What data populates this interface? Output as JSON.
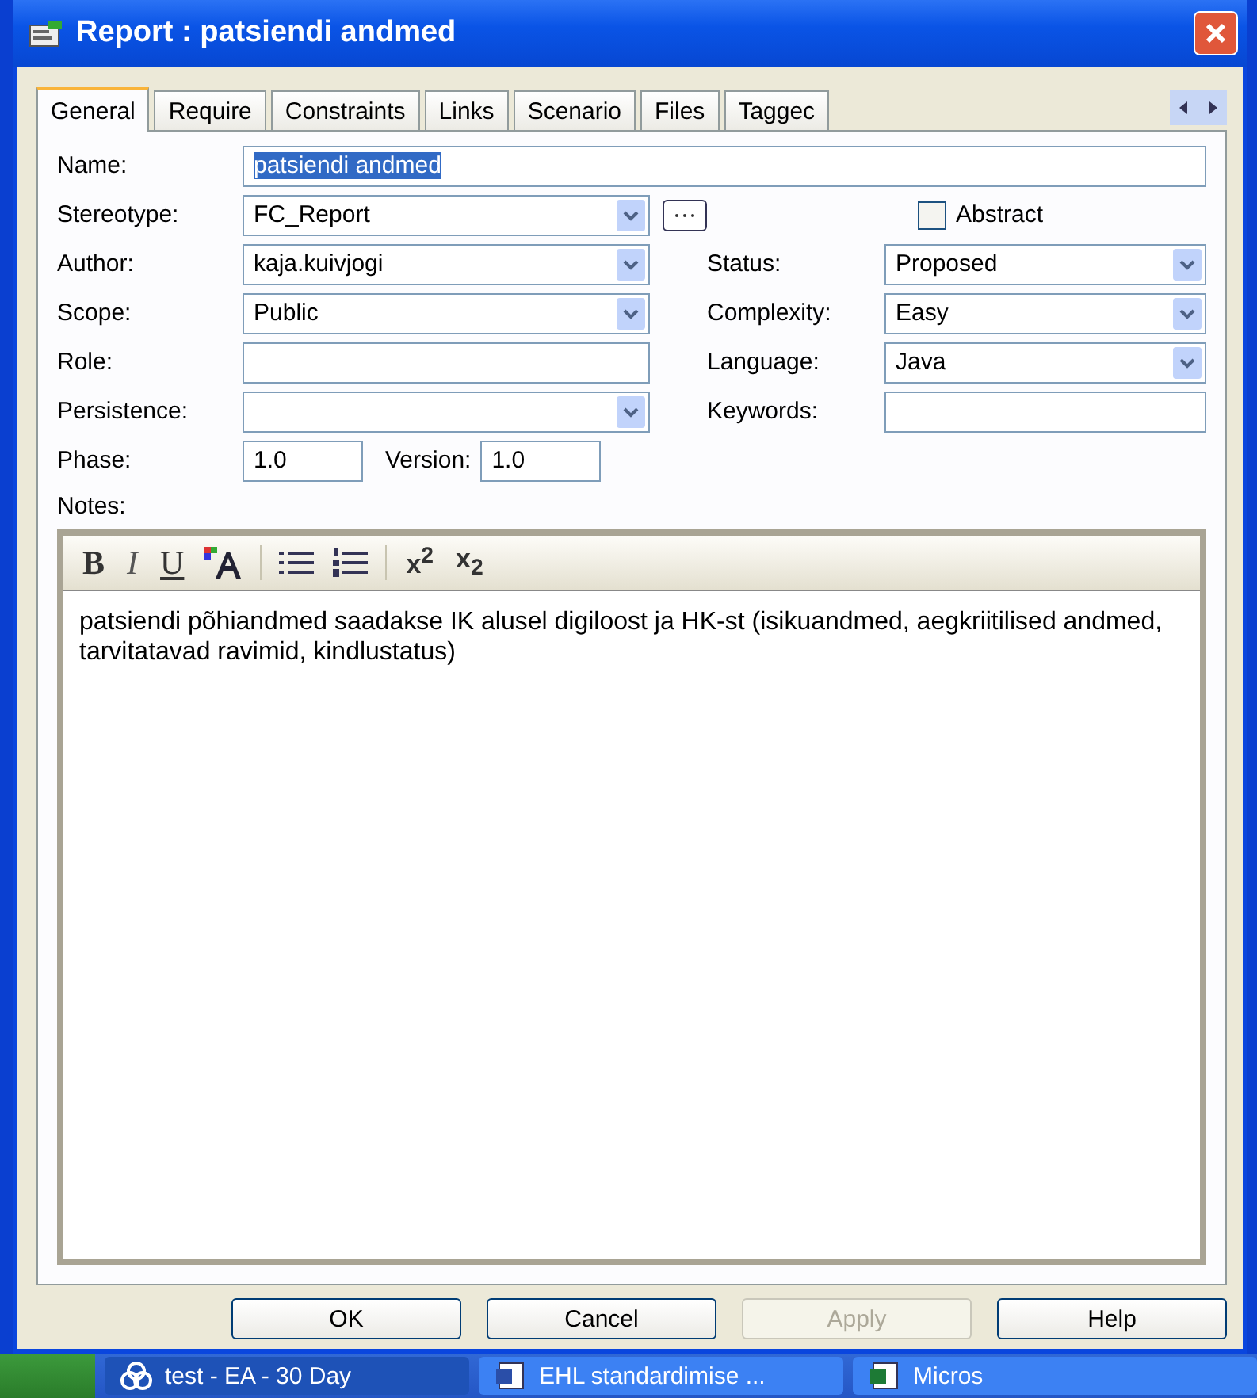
{
  "window": {
    "title": "Report : patsiendi andmed"
  },
  "tabs": [
    {
      "label": "General",
      "selected": true
    },
    {
      "label": "Require",
      "selected": false
    },
    {
      "label": "Constraints",
      "selected": false
    },
    {
      "label": "Links",
      "selected": false
    },
    {
      "label": "Scenario",
      "selected": false
    },
    {
      "label": "Files",
      "selected": false
    },
    {
      "label": "Taggec",
      "selected": false
    }
  ],
  "name_field": {
    "label": "Name:",
    "value": "patsiendi andmed",
    "highlighted": true
  },
  "left_fields": [
    {
      "label": "Stereotype:",
      "kind": "dropdown",
      "value": "FC_Report"
    },
    {
      "label": "Author:",
      "kind": "dropdown",
      "value": "kaja.kuivjogi"
    },
    {
      "label": "Scope:",
      "kind": "dropdown",
      "value": "Public"
    },
    {
      "label": "Role:",
      "kind": "text"
    },
    {
      "label": "Persistence:",
      "kind": "dropdown"
    }
  ],
  "abstract": {
    "label": "Abstract",
    "checked": false
  },
  "right_fields": [
    {
      "label": "Status:",
      "kind": "dropdown",
      "value": "Proposed"
    },
    {
      "label": "Complexity:",
      "kind": "dropdown",
      "value": "Easy"
    },
    {
      "label": "Language:",
      "kind": "dropdown",
      "value": "Java"
    },
    {
      "label": "Keywords:",
      "kind": "text"
    }
  ],
  "phase": {
    "label": "Phase:",
    "value": "1.0"
  },
  "version": {
    "label": "Version:",
    "value": "1.0"
  },
  "notes": {
    "label": "Notes:",
    "text": "patsiendi põhiandmed saadakse IK alusel digiloost ja HK-st (isikuandmed, aegkriitilised andmed, tarvitatavad ravimid, kindlustatus)"
  },
  "toolbar": [
    {
      "kind": "bold",
      "label": "B"
    },
    {
      "kind": "italic",
      "label": "I"
    },
    {
      "kind": "underline",
      "label": "U"
    },
    {
      "kind": "color"
    },
    {
      "kind": "sep"
    },
    {
      "kind": "bullets"
    },
    {
      "kind": "numbering"
    },
    {
      "kind": "sep"
    },
    {
      "kind": "sup",
      "label": "x$^{2}$"
    },
    {
      "kind": "sub",
      "label": "x$_{2}$"
    }
  ],
  "buttons": [
    {
      "label": "OK",
      "disabled": false
    },
    {
      "label": "Cancel",
      "disabled": false
    },
    {
      "label": "Apply",
      "disabled": true
    },
    {
      "label": "Help",
      "disabled": false
    }
  ],
  "taskbar": [
    {
      "label": "test - EA - 30 Day",
      "selected": true
    },
    {
      "label": "EHL standardimise ...",
      "selected": false
    },
    {
      "label": "Micros",
      "selected": false
    }
  ]
}
